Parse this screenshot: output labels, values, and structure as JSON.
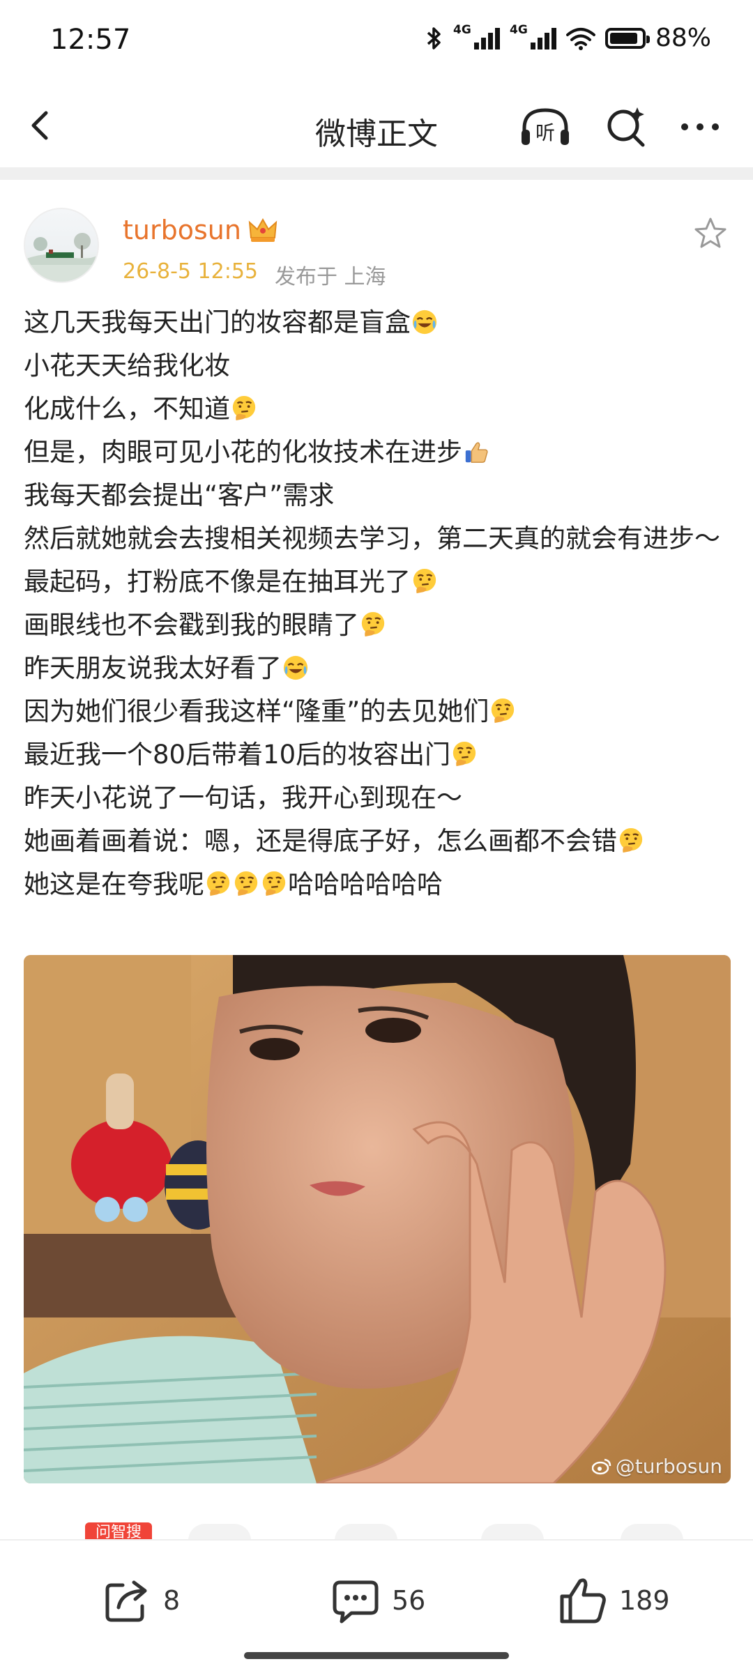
{
  "status_bar": {
    "time": "12:57",
    "network_1": "4G",
    "network_2": "4G",
    "battery_percent": "88%",
    "battery_level": 0.88,
    "icons": [
      "bluetooth-icon",
      "signal-icon",
      "signal-icon",
      "wifi-icon",
      "battery-icon"
    ]
  },
  "nav": {
    "title": "微博正文",
    "listen_label": "听",
    "icons": [
      "back-arrow-icon",
      "listen-headphones-icon",
      "ai-search-icon",
      "more-icon"
    ]
  },
  "author": {
    "name": "turbosun",
    "badge_icon": "crown-icon",
    "time": "26-8-5 12:55",
    "location": "发布于 上海"
  },
  "post": {
    "lines": [
      "这几天我每天出门的妆容都是盲盒",
      "小花天天给我化妆",
      "化成什么，不知道",
      "但是，肉眼可见小花的化妆技术在进步",
      "我每天都会提出“客户”需求",
      "然后就她就会去搜相关视频去学习，第二天真的就会有进步～",
      "最起码，打粉底不像是在抽耳光了",
      "画眼线也不会戳到我的眼睛了",
      "昨天朋友说我太好看了",
      "因为她们很少看我这样“隆重”的去见她们",
      "最近我一个80后带着10后的妆容出门",
      "昨天小花说了一句话，我开心到现在～",
      "她画着画着说：嗯，还是得底子好，怎么画都不会错",
      "她这是在夸我呢",
      "哈哈哈哈哈哈"
    ],
    "emoji": [
      "laugh-cry-emoji",
      "thinking-emoji",
      "thumbs-up-emoji"
    ],
    "image_watermark": "@turbosun"
  },
  "partial_row": {
    "ai_tag": "问智搜"
  },
  "actions": {
    "repost_count": "8",
    "comment_count": "56",
    "like_count": "189"
  },
  "colors": {
    "author_name": "#e8742c",
    "timestamp": "#e8b23c",
    "ai_tag": "#f04438"
  }
}
